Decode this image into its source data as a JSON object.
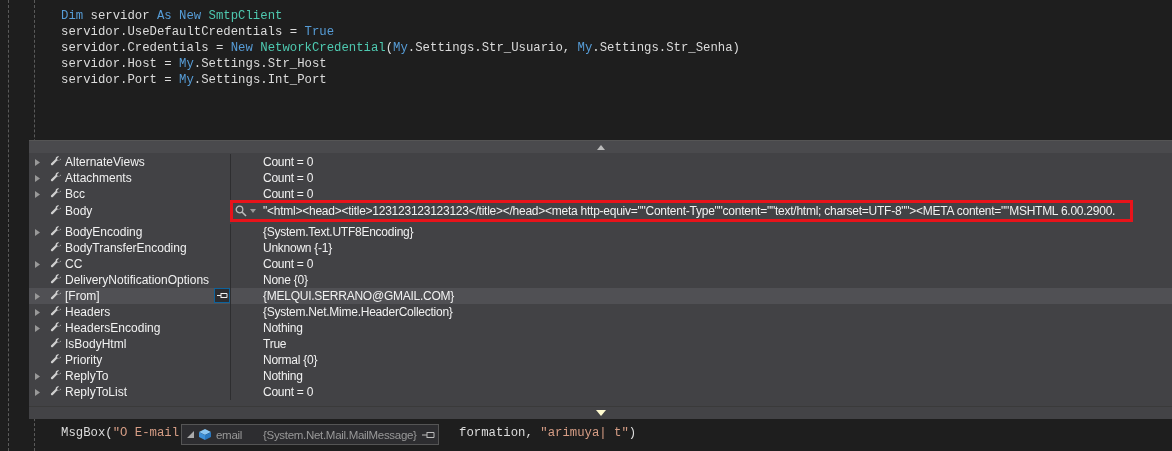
{
  "code_lines": [
    {
      "tokens": [
        {
          "kind": "keyword",
          "text": "Dim"
        },
        {
          "kind": "text",
          "text": " servidor "
        },
        {
          "kind": "keyword",
          "text": "As New"
        },
        {
          "kind": "type",
          "text": " SmtpClient"
        }
      ]
    },
    {
      "tokens": [
        {
          "kind": "text",
          "text": "servidor.UseDefaultCredentials = "
        },
        {
          "kind": "keyword",
          "text": "True"
        }
      ]
    },
    {
      "tokens": [
        {
          "kind": "text",
          "text": "servidor.Credentials = "
        },
        {
          "kind": "keyword",
          "text": "New"
        },
        {
          "kind": "type",
          "text": " NetworkCredential"
        },
        {
          "kind": "text",
          "text": "("
        },
        {
          "kind": "keyword",
          "text": "My"
        },
        {
          "kind": "text",
          "text": ".Settings.Str_Usuario, "
        },
        {
          "kind": "keyword",
          "text": "My"
        },
        {
          "kind": "text",
          "text": ".Settings.Str_Senha)"
        }
      ]
    },
    {
      "tokens": [
        {
          "kind": "text",
          "text": "servidor.Host = "
        },
        {
          "kind": "keyword",
          "text": "My"
        },
        {
          "kind": "text",
          "text": ".Settings.Str_Host"
        }
      ]
    },
    {
      "tokens": [
        {
          "kind": "text",
          "text": "servidor.Port = "
        },
        {
          "kind": "keyword",
          "text": "My"
        },
        {
          "kind": "text",
          "text": ".Settings.Int_Port"
        }
      ]
    }
  ],
  "watch_rows": [
    {
      "name": "AlternateViews",
      "value": "Count = 0",
      "expandable": true,
      "selected": false,
      "kind": "plain"
    },
    {
      "name": "Attachments",
      "value": "Count = 0",
      "expandable": true,
      "selected": false,
      "kind": "plain"
    },
    {
      "name": "Bcc",
      "value": "Count = 0",
      "expandable": true,
      "selected": false,
      "kind": "plain"
    },
    {
      "name": "Body",
      "value": "\"<html><head><title>123123123123123</title></head><meta http-equiv=\"\"Content-Type\"\"content=\"\"text/html; charset=UTF-8\"\"><META content=\"\"MSHTML 6.00.2900.",
      "expandable": false,
      "selected": false,
      "kind": "visualizer"
    },
    {
      "name": "BodyEncoding",
      "value": "{System.Text.UTF8Encoding}",
      "expandable": true,
      "selected": false,
      "kind": "plain"
    },
    {
      "name": "BodyTransferEncoding",
      "value": "Unknown {-1}",
      "expandable": false,
      "selected": false,
      "kind": "plain"
    },
    {
      "name": "CC",
      "value": "Count = 0",
      "expandable": true,
      "selected": false,
      "kind": "plain"
    },
    {
      "name": "DeliveryNotificationOptions",
      "value": "None {0}",
      "expandable": false,
      "selected": false,
      "kind": "plain"
    },
    {
      "name": "[From]",
      "value": "{MELQUI.SERRANO@GMAIL.COM}",
      "expandable": true,
      "selected": true,
      "kind": "pinnable"
    },
    {
      "name": "Headers",
      "value": "{System.Net.Mime.HeaderCollection}",
      "expandable": true,
      "selected": false,
      "kind": "plain"
    },
    {
      "name": "HeadersEncoding",
      "value": "Nothing",
      "expandable": true,
      "selected": false,
      "kind": "plain"
    },
    {
      "name": "IsBodyHtml",
      "value": "True",
      "expandable": false,
      "selected": false,
      "kind": "plain"
    },
    {
      "name": "Priority",
      "value": "Normal {0}",
      "expandable": false,
      "selected": false,
      "kind": "plain"
    },
    {
      "name": "ReplyTo",
      "value": "Nothing",
      "expandable": true,
      "selected": false,
      "kind": "plain"
    },
    {
      "name": "ReplyToList",
      "value": "Count = 0",
      "expandable": true,
      "selected": false,
      "kind": "plain"
    }
  ],
  "bottom_code_line": {
    "before": [
      {
        "kind": "text",
        "text": "MsgBox("
      },
      {
        "kind": "string",
        "text": "\"O E-mail"
      }
    ],
    "after": [
      {
        "kind": "text",
        "text": "formation, "
      },
      {
        "kind": "string",
        "text": "\"arimuya| t\""
      },
      {
        "kind": "text",
        "text": ")"
      }
    ]
  },
  "data_tip": {
    "name": "email",
    "value": "{System.Net.Mail.MailMessage}"
  }
}
